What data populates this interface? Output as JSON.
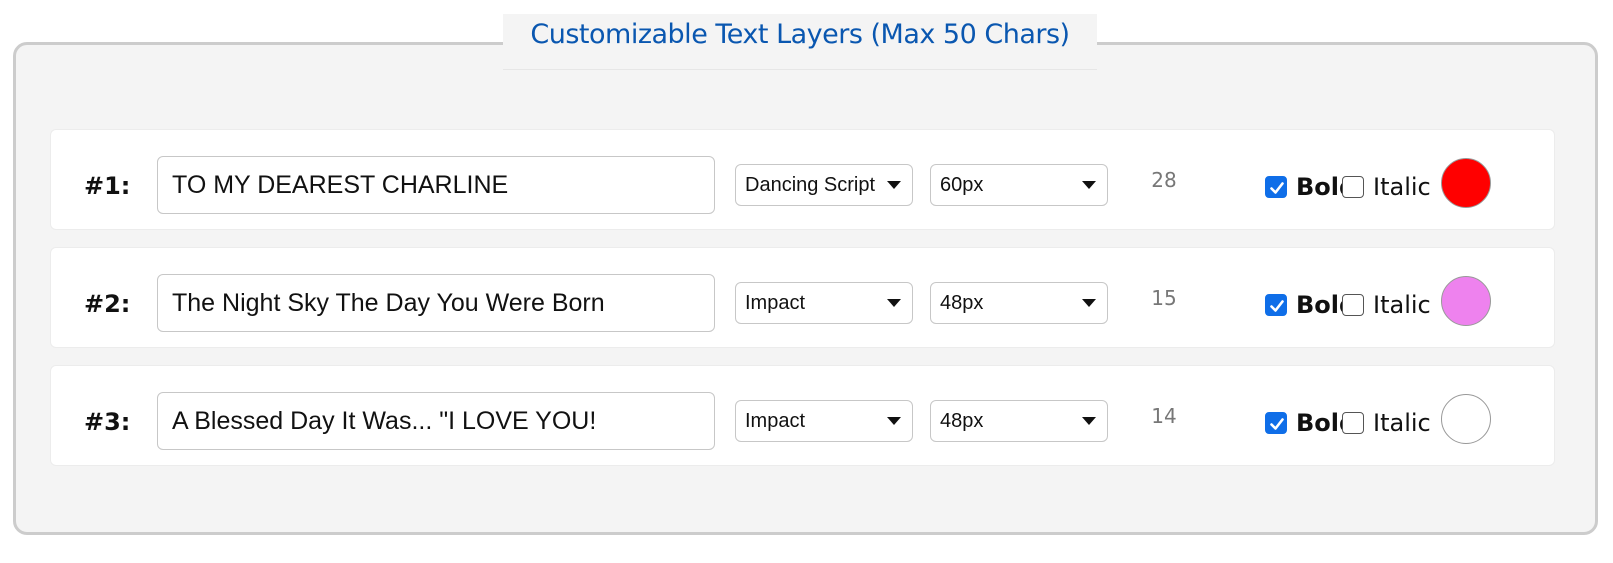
{
  "legend": {
    "title": "Customizable Text Layers (Max 50 Chars)"
  },
  "layers": [
    {
      "label": "#1:",
      "text": "TO MY DEAREST CHARLINE",
      "font": "Dancing Script",
      "size": "60px",
      "count": "28",
      "bold_label": "Bold",
      "bold_checked": true,
      "italic_label": "Italic",
      "italic_checked": false,
      "color": "#ff0000"
    },
    {
      "label": "#2:",
      "text": "The Night Sky The Day You Were Born",
      "font": "Impact",
      "size": "48px",
      "count": "15",
      "bold_label": "Bold",
      "bold_checked": true,
      "italic_label": "Italic",
      "italic_checked": false,
      "color": "#ee82ee"
    },
    {
      "label": "#3:",
      "text": "A Blessed Day It Was... \"I LOVE YOU!",
      "font": "Impact",
      "size": "48px",
      "count": "14",
      "bold_label": "Bold",
      "bold_checked": true,
      "italic_label": "Italic",
      "italic_checked": false,
      "color": "#ffffff"
    }
  ]
}
